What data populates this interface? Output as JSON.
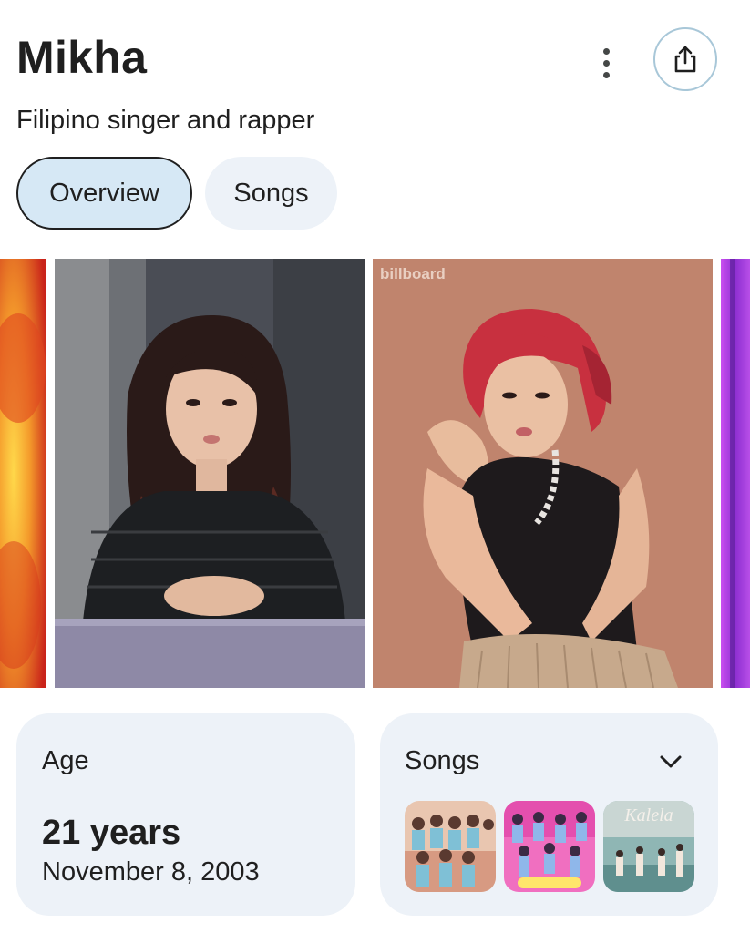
{
  "header": {
    "title": "Mikha",
    "subtitle": "Filipino singer and rapper",
    "more_icon": "more-vert-icon",
    "share_icon": "share-icon"
  },
  "tabs": [
    {
      "label": "Overview",
      "selected": true
    },
    {
      "label": "Songs",
      "selected": false
    }
  ],
  "images": {
    "watermark": "billboard"
  },
  "age_card": {
    "label": "Age",
    "value": "21 years",
    "birthdate": "November 8, 2003"
  },
  "songs_card": {
    "label": "Songs",
    "expand_icon": "chevron-down-icon",
    "thumb3_text": "Kalela"
  },
  "colors": {
    "chip_selected_bg": "#d6e8f5",
    "card_bg": "#edf2f8",
    "share_border": "#a8c7d8"
  }
}
